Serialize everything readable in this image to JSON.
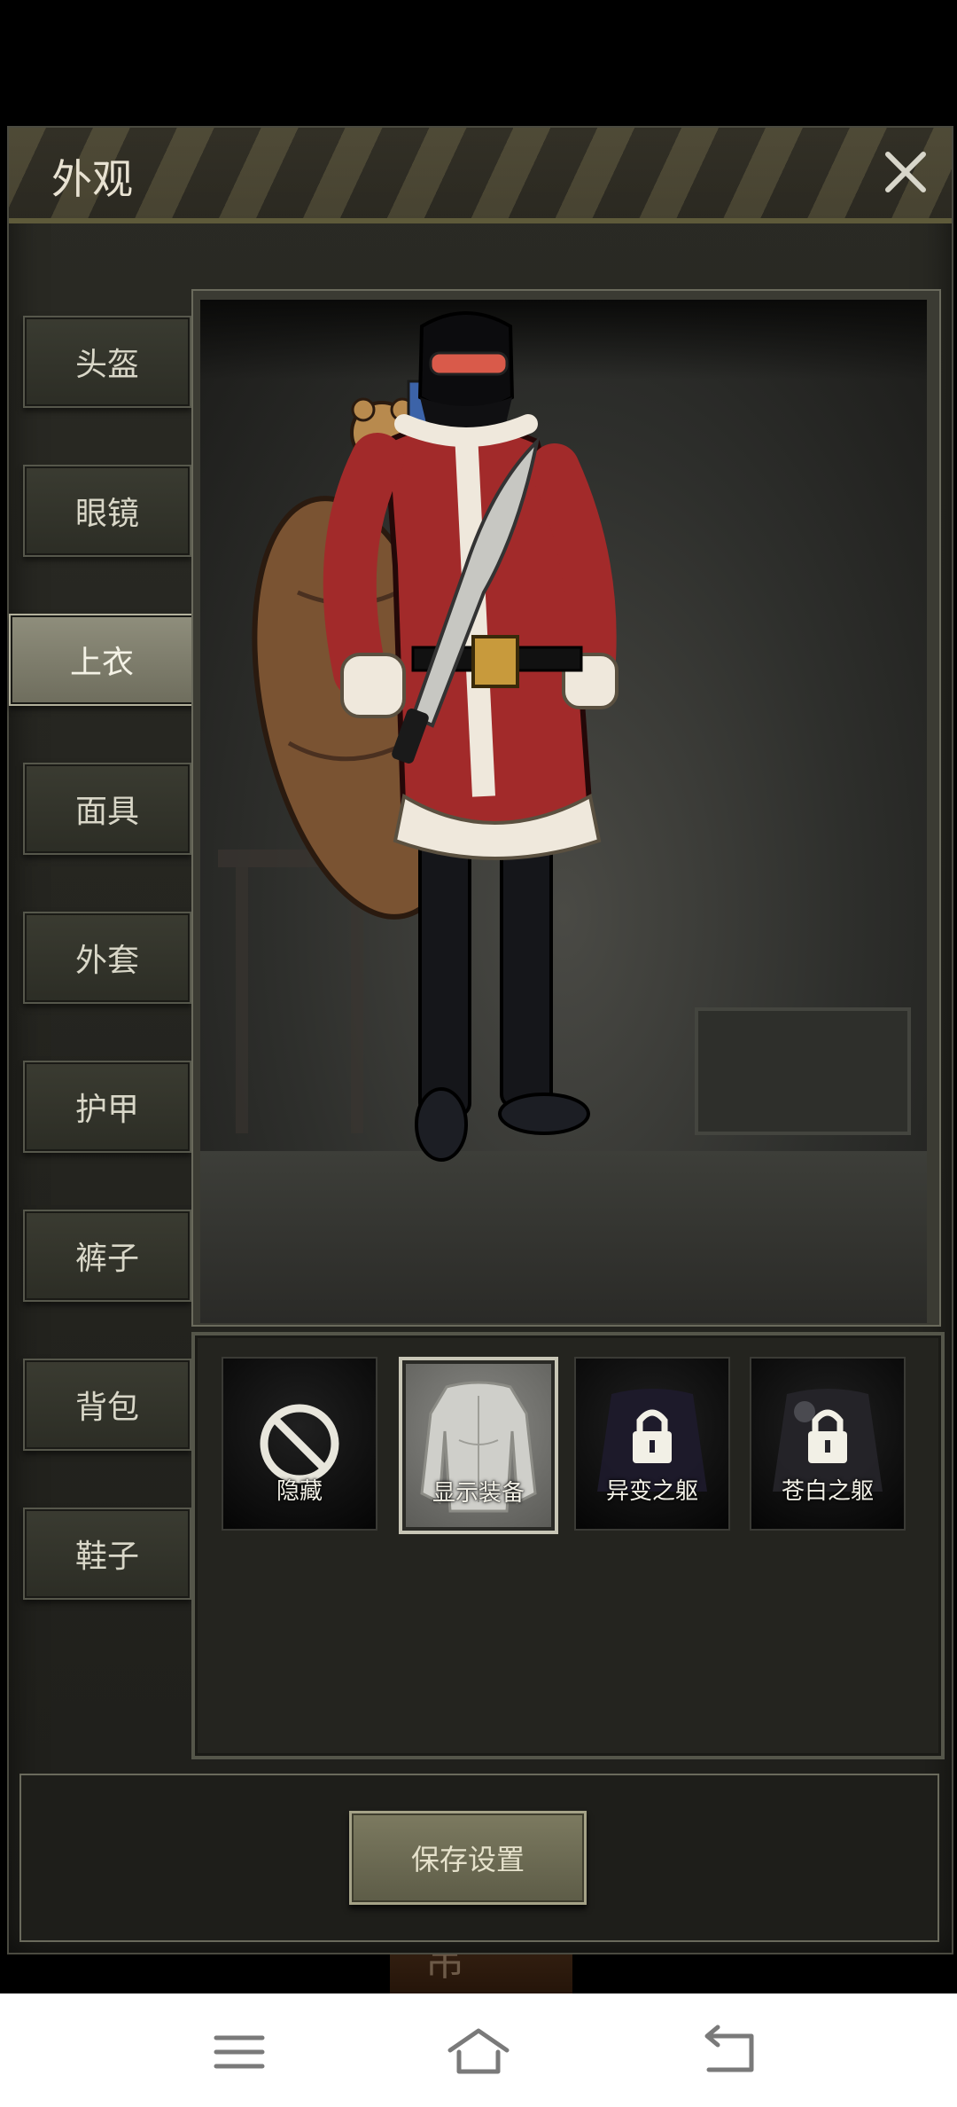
{
  "dialog": {
    "title": "外观"
  },
  "categories": [
    {
      "label": "头盔"
    },
    {
      "label": "眼镜"
    },
    {
      "label": "上衣",
      "active": true
    },
    {
      "label": "面具"
    },
    {
      "label": "外套"
    },
    {
      "label": "护甲"
    },
    {
      "label": "裤子"
    },
    {
      "label": "背包"
    },
    {
      "label": "鞋子"
    }
  ],
  "options": [
    {
      "label": "隐藏",
      "icon": "prohibited-icon",
      "selected": false,
      "locked": false
    },
    {
      "label": "显示装备",
      "icon": "torso-icon",
      "selected": true,
      "locked": false
    },
    {
      "label": "异变之躯",
      "icon": "lock-icon",
      "selected": false,
      "locked": true
    },
    {
      "label": "苍白之躯",
      "icon": "lock-icon",
      "selected": false,
      "locked": true
    }
  ],
  "save_button": {
    "label": "保存设置"
  },
  "underlying_button": {
    "label": "吊 〇"
  },
  "colors": {
    "accent_stripe": "#5e5a3a",
    "panel_bg": "#24241f",
    "active_tab": "#8f8e7c"
  }
}
